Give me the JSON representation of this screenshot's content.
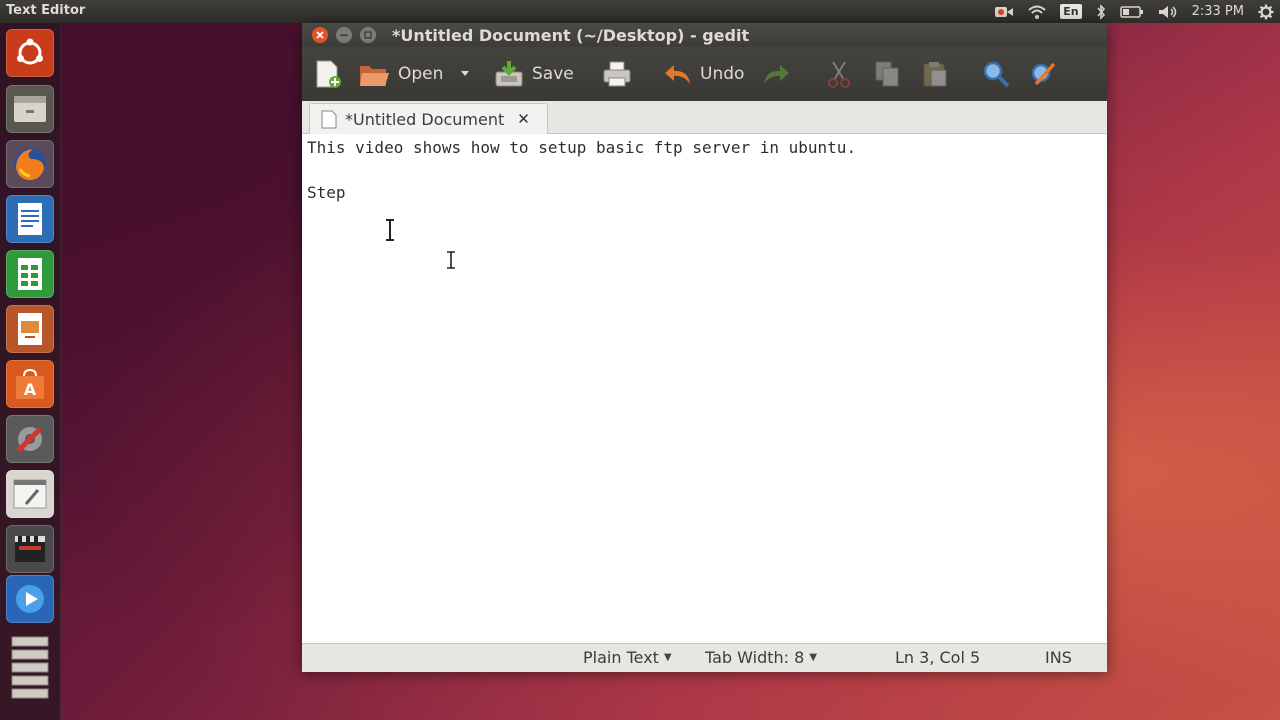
{
  "panel": {
    "app_title": "Text Editor",
    "language": "En",
    "clock": "2:33 PM",
    "indicator_icons": [
      "record-icon",
      "wifi-icon",
      "language-icon",
      "bluetooth-icon",
      "battery-icon",
      "volume-icon",
      "clock",
      "gear-icon"
    ]
  },
  "launcher": {
    "items": [
      "dash-home-icon",
      "files-icon",
      "firefox-icon",
      "writer-icon",
      "calc-icon",
      "impress-icon",
      "software-center-icon",
      "system-settings-icon",
      "text-editor-icon",
      "video-editor-icon",
      "media-player-icon",
      "workspaces-icon"
    ]
  },
  "window": {
    "title": "*Untitled Document (~/Desktop) - gedit"
  },
  "toolbar": {
    "open_label": "Open",
    "save_label": "Save",
    "undo_label": "Undo"
  },
  "tab": {
    "label": "*Untitled Document",
    "close_glyph": "✕"
  },
  "editor": {
    "lines": [
      "This video shows how to setup basic ftp server in ubuntu.",
      "",
      "Step"
    ]
  },
  "statusbar": {
    "language": "Plain Text",
    "tab_width": "Tab Width: 8",
    "position": "Ln 3, Col 5",
    "mode": "INS"
  },
  "colors": {
    "close_button": "#e2552c",
    "accent_orange": "#dd4814",
    "panel_bg": "#3c3b37"
  }
}
